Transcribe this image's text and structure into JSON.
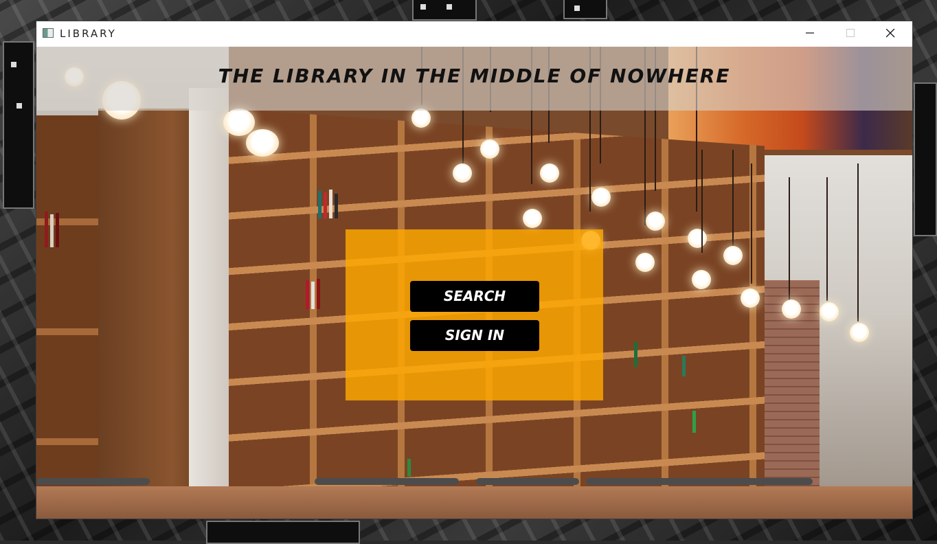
{
  "window": {
    "title": "LIBRARY",
    "controls": {
      "minimize": "minimize-icon",
      "maximize": "maximize-icon",
      "close": "close-icon"
    }
  },
  "banner": {
    "title": "THE LIBRARY IN THE MIDDLE OF NOWHERE"
  },
  "menu": {
    "search_label": "SEARCH",
    "signin_label": "SIGN IN"
  },
  "colors": {
    "panel": "#FFA800",
    "button_bg": "#000000",
    "button_text": "#FFFFFF"
  }
}
